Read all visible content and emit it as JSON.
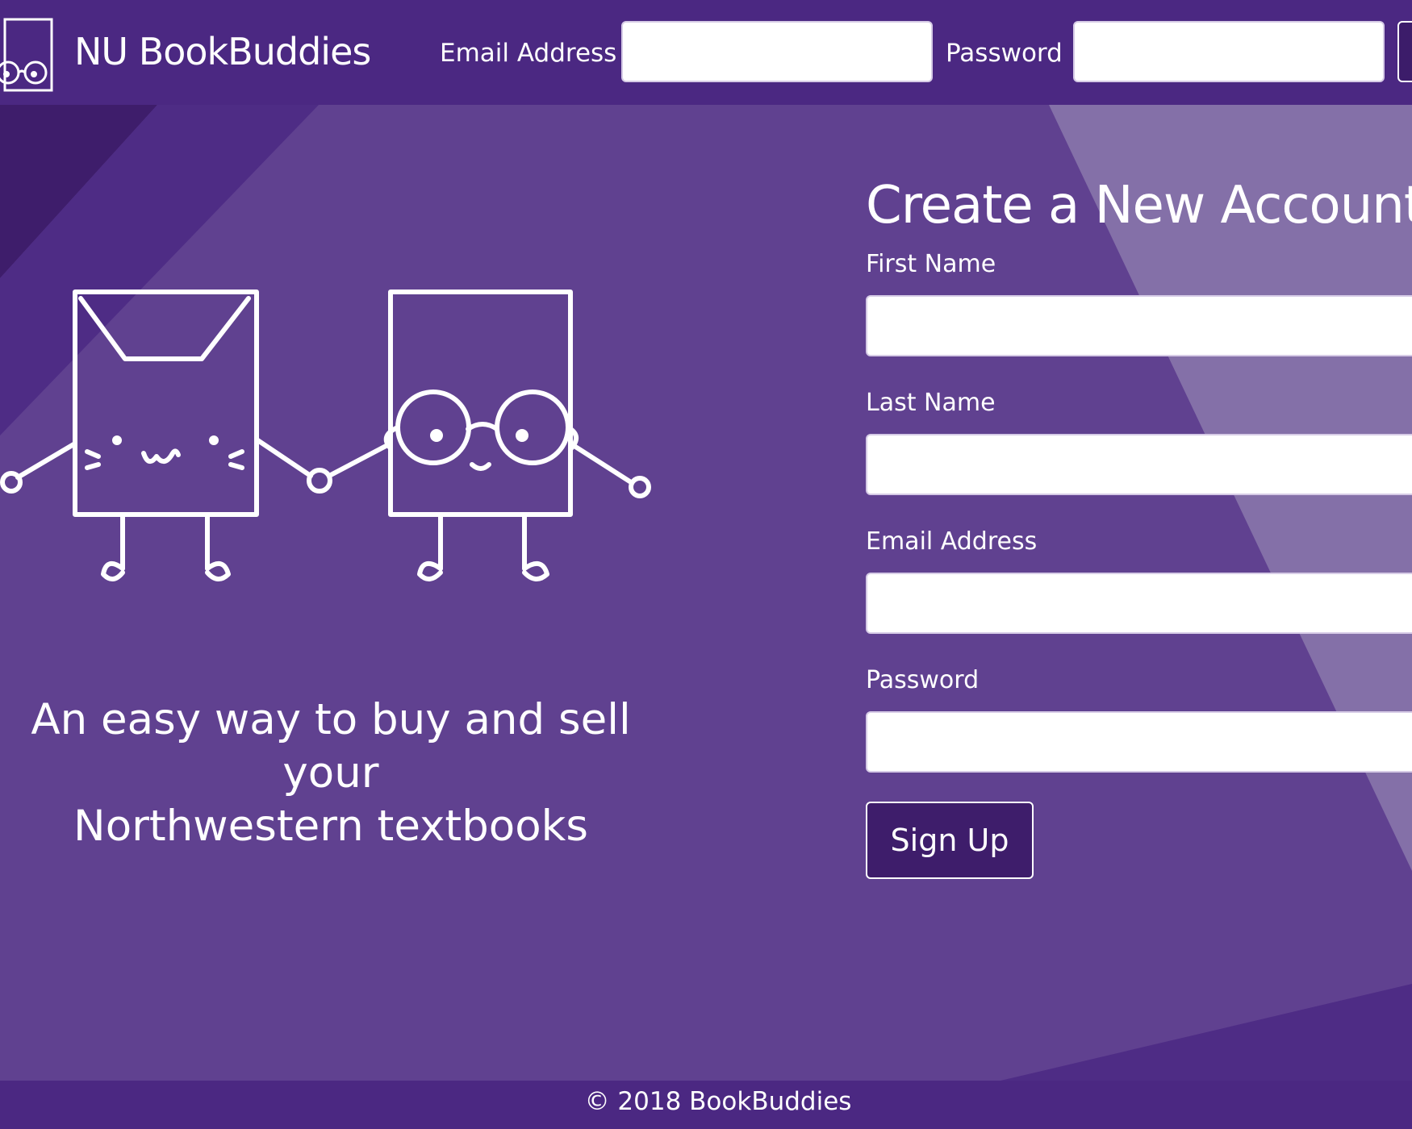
{
  "navbar": {
    "brand": "NU BookBuddies",
    "email_label": "Email Address",
    "password_label": "Password"
  },
  "hero": {
    "tagline_line1": "An easy way to buy and sell your",
    "tagline_line2": "Northwestern textbooks"
  },
  "signup_form": {
    "title": "Create a New Account",
    "first_name_label": "First Name",
    "last_name_label": "Last Name",
    "email_label": "Email Address",
    "password_label": "Password",
    "submit_label": "Sign Up"
  },
  "footer": {
    "copyright": "© 2018 BookBuddies"
  },
  "colors": {
    "background": "#604190",
    "navbar": "#4b2882",
    "button": "#3e1d6b",
    "light_stripe": "#8470a8"
  },
  "icons": {
    "logo": "book-with-glasses-icon",
    "illustration": "cat-book-and-glasses-book-holding-hands"
  }
}
